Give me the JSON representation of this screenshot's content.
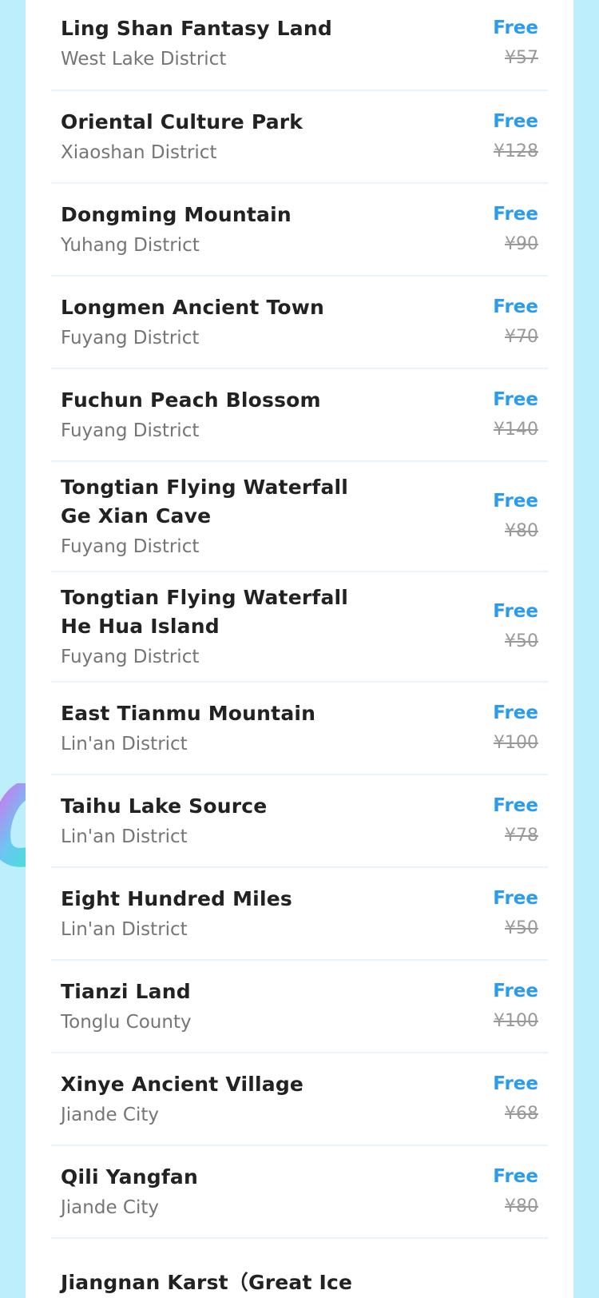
{
  "list": {
    "items": [
      {
        "name": "Ling Shan Fantasy Land",
        "district": "West Lake District",
        "price_label": "Free",
        "original_price": "¥57"
      },
      {
        "name": "Oriental Culture Park",
        "district": "Xiaoshan District",
        "price_label": "Free",
        "original_price": "¥128"
      },
      {
        "name": "Dongming Mountain",
        "district": "Yuhang District",
        "price_label": "Free",
        "original_price": "¥90"
      },
      {
        "name": "Longmen Ancient Town",
        "district": "Fuyang District",
        "price_label": "Free",
        "original_price": "¥70"
      },
      {
        "name": "Fuchun Peach Blossom",
        "district": "Fuyang District",
        "price_label": "Free",
        "original_price": "¥140"
      },
      {
        "name": "Tongtian Flying Waterfall Ge Xian Cave",
        "district": "Fuyang District",
        "price_label": "Free",
        "original_price": "¥80"
      },
      {
        "name": "Tongtian Flying Waterfall He Hua Island",
        "district": "Fuyang District",
        "price_label": "Free",
        "original_price": "¥50"
      },
      {
        "name": "East Tianmu Mountain",
        "district": "Lin'an District",
        "price_label": "Free",
        "original_price": "¥100"
      },
      {
        "name": "Taihu Lake Source",
        "district": "Lin'an District",
        "price_label": "Free",
        "original_price": "¥78"
      },
      {
        "name": "Eight Hundred Miles",
        "district": "Lin'an District",
        "price_label": "Free",
        "original_price": "¥50"
      },
      {
        "name": "Tianzi Land",
        "district": "Tonglu County",
        "price_label": "Free",
        "original_price": "¥100"
      },
      {
        "name": "Xinye Ancient Village",
        "district": "Jiande City",
        "price_label": "Free",
        "original_price": "¥68"
      },
      {
        "name": "Qili Yangfan",
        "district": "Jiande City",
        "price_label": "Free",
        "original_price": "¥80"
      },
      {
        "name": "Jiangnan Karst（Great Ice",
        "district": "",
        "price_label": "",
        "original_price": ""
      }
    ]
  },
  "colors": {
    "background": "#bdeefc",
    "card": "#ffffff",
    "accent_free": "#2a9bf0",
    "divider": "#e6f4fb"
  },
  "decor": {
    "icon": "ribbon-decoration-icon"
  }
}
